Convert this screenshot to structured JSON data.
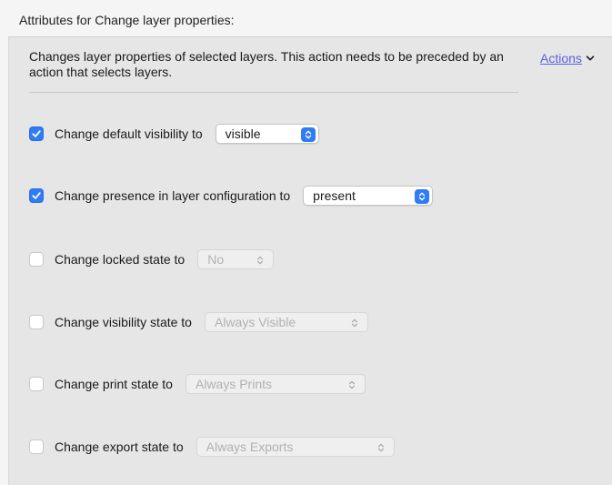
{
  "header": {
    "title": "Attributes for Change layer properties:"
  },
  "panel": {
    "description": "Changes layer properties of selected layers. This action needs to be preceded by an action that selects layers.",
    "actions_label": "Actions"
  },
  "rows": [
    {
      "label": "Change default visibility to",
      "checked": true,
      "value": "visible",
      "enabled": true
    },
    {
      "label": "Change presence in layer configuration to",
      "checked": true,
      "value": "present",
      "enabled": true
    },
    {
      "label": "Change locked state to",
      "checked": false,
      "value": "No",
      "enabled": false
    },
    {
      "label": "Change visibility state to",
      "checked": false,
      "value": "Always Visible",
      "enabled": false
    },
    {
      "label": "Change print state to",
      "checked": false,
      "value": "Always Prints",
      "enabled": false
    },
    {
      "label": "Change export state to",
      "checked": false,
      "value": "Always Exports",
      "enabled": false
    }
  ],
  "colors": {
    "accent": "#2f7cf6",
    "link": "#5b5fe0",
    "panel_bg": "#e6e6e6"
  },
  "icons": {
    "checkmark": "checkmark-icon",
    "stepper": "up-down-chevron-icon",
    "actions_menu": "chevron-down-icon"
  }
}
